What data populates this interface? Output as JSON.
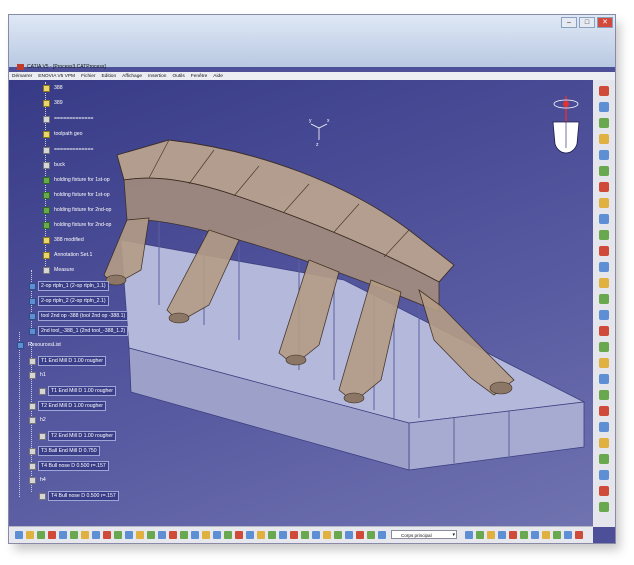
{
  "window": {
    "title": "CATIA V5 - [Process3.CATProcess]",
    "controls": {
      "minimize": "–",
      "maximize": "□",
      "close": "✕"
    }
  },
  "menu": {
    "items": [
      "Démarrer",
      "ENOVIA V5 VPM",
      "Fichier",
      "Edition",
      "Affichage",
      "Insertion",
      "Outils",
      "Fenêtre",
      "Aide"
    ]
  },
  "tree": {
    "nodes": [
      {
        "label": "388",
        "boxed": false
      },
      {
        "label": "389",
        "boxed": false
      },
      {
        "label": "=============",
        "boxed": false
      },
      {
        "label": "toolpath geo",
        "boxed": false
      },
      {
        "label": "=============",
        "boxed": false
      },
      {
        "label": "buck",
        "boxed": false
      },
      {
        "label": "holding fixture for 1st-op",
        "boxed": false
      },
      {
        "label": "holding fixture for 1st-op",
        "boxed": false
      },
      {
        "label": "holding fixture for 2nd-op",
        "boxed": false
      },
      {
        "label": "holding fixture for 2nd-op",
        "boxed": false
      },
      {
        "label": "388 modified",
        "boxed": false
      },
      {
        "label": "Annotation Set.1",
        "boxed": false
      },
      {
        "label": "Measure",
        "boxed": false
      },
      {
        "label": "2-op rtpln_1 (2-op rtpln_1.1)",
        "boxed": true
      },
      {
        "label": "2-op rtpln_2 (2-op rtpln_2.1)",
        "boxed": true
      },
      {
        "label": "tool 2nd op -388 (tool 2nd op -388.1)",
        "boxed": true
      },
      {
        "label": "2nd tool_-388_1 (2nd tool_-388_1.2)",
        "boxed": true
      },
      {
        "label": "ResourcesList",
        "boxed": false
      },
      {
        "label": "T1 End Mill D 1.00 rougher",
        "boxed": true
      },
      {
        "label": "h1",
        "boxed": false
      },
      {
        "label": "T1 End Mill D 1.00 rougher",
        "boxed": true
      },
      {
        "label": "T2 End Mill D 1.00 rougher",
        "boxed": true
      },
      {
        "label": "h2",
        "boxed": false
      },
      {
        "label": "T2 End Mill D 1.00 rougher",
        "boxed": true
      },
      {
        "label": "T3 Ball End Mill D 0.750",
        "boxed": true
      },
      {
        "label": "T4 Bull nose D 0.500 r=.157",
        "boxed": true
      },
      {
        "label": "h4",
        "boxed": false
      },
      {
        "label": "T4 Bull nose D 0.500 r=.157",
        "boxed": true
      }
    ]
  },
  "compass": {
    "axis_x": "x",
    "axis_y": "y",
    "axis_z": "z"
  },
  "bottom_toolbar": {
    "layer_value": "Corps principal"
  },
  "colors": {
    "viewport_bg": "#4d4f98",
    "model_fixture": "#b59d86",
    "model_base": "#b4b8da",
    "accent_compass": "#e43030"
  }
}
